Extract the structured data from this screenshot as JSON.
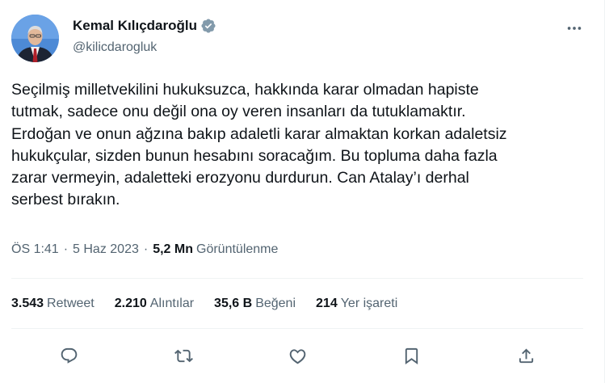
{
  "author": {
    "name": "Kemal Kılıçdaroğlu",
    "handle": "@kilicdarogluk",
    "verified": true,
    "avatar_icon": "profile-photo"
  },
  "tweet": {
    "lines": [
      "Seçilmiş milletvekilini hukuksuzca, hakkında karar olmadan hapiste",
      "tutmak, sadece onu değil ona oy veren insanları da tutuklamaktır.",
      "Erdoğan ve onun ağzına bakıp adaletli karar almaktan korkan adaletsiz",
      "hukukçular, sizden bunun hesabını soracağım. Bu topluma daha fazla",
      "zarar vermeyin, adaletteki erozyonu durdurun. Can Atalay’ı derhal",
      "serbest bırakın."
    ]
  },
  "meta": {
    "time": "ÖS 1:41",
    "separator": "·",
    "date": "5 Haz 2023",
    "views_count": "5,2 Mn",
    "views_label": "Görüntülenme"
  },
  "stats": {
    "retweets": {
      "count": "3.543",
      "label": "Retweet"
    },
    "quotes": {
      "count": "2.210",
      "label": "Alıntılar"
    },
    "likes": {
      "count": "35,6 B",
      "label": "Beğeni"
    },
    "bookmarks": {
      "count": "214",
      "label": "Yer işareti"
    }
  },
  "actions": [
    "reply-icon",
    "retweet-icon",
    "like-icon",
    "bookmark-icon",
    "share-icon"
  ],
  "colors": {
    "text": "#0f1419",
    "secondary": "#536471",
    "divider": "#eff3f4",
    "verified_badge": "#829aab"
  }
}
